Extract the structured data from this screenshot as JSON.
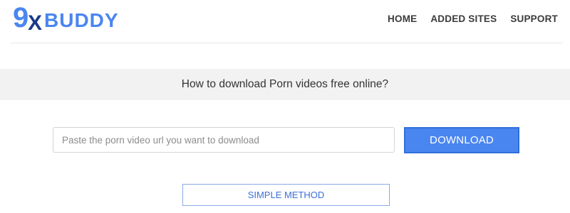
{
  "logo": {
    "text_nine": "9",
    "text_x": "X",
    "text_buddy": "BUDDY",
    "brand_color": "#4a86f0",
    "dark_color": "#1a3a8a"
  },
  "nav": {
    "items": [
      {
        "label": "HOME"
      },
      {
        "label": "ADDED SITES"
      },
      {
        "label": "SUPPORT"
      }
    ]
  },
  "main": {
    "heading": "How to download Porn videos free online?",
    "search": {
      "placeholder": "Paste the porn video url you want to download",
      "value": ""
    },
    "download_label": "DOWNLOAD",
    "simple_method_label": "SIMPLE METHOD"
  },
  "colors": {
    "accent": "#4a86f0",
    "banner_bg": "#f2f2f2"
  }
}
